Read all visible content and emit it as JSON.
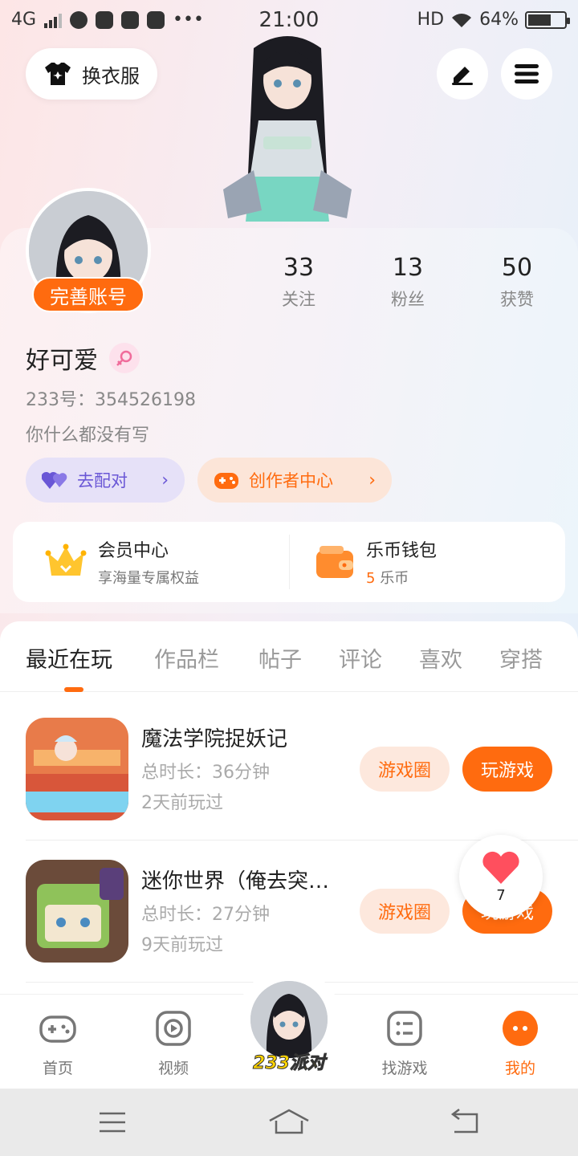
{
  "status_bar": {
    "network": "4G",
    "time": "21:00",
    "hd": "HD",
    "battery": "64%",
    "battery_level": 0.64
  },
  "header": {
    "change_clothes_label": "换衣服"
  },
  "profile": {
    "complete_account_label": "完善账号",
    "nickname": "好可爱",
    "id_line": "233号：354526198",
    "bio": "你什么都没有写",
    "stats": [
      {
        "value": "33",
        "label": "关注"
      },
      {
        "value": "13",
        "label": "粉丝"
      },
      {
        "value": "50",
        "label": "获赞"
      }
    ],
    "match_label": "去配对",
    "creator_label": "创作者中心"
  },
  "member": {
    "title": "会员中心",
    "subtitle": "享海量专属权益"
  },
  "wallet": {
    "title": "乐币钱包",
    "amount": "5",
    "unit": "乐币"
  },
  "tabs": [
    "最近在玩",
    "作品栏",
    "帖子",
    "评论",
    "喜欢",
    "穿搭"
  ],
  "games": [
    {
      "name": "魔法学院捉妖记",
      "duration": "总时长：36分钟",
      "last_played": "2天前玩过",
      "circle_label": "游戏圈",
      "play_label": "玩游戏"
    },
    {
      "name": "迷你世界（俺去突…",
      "duration": "总时长：27分钟",
      "last_played": "9天前玩过",
      "circle_label": "游戏圈",
      "play_label": "玩游戏"
    }
  ],
  "like_float": {
    "count": "7"
  },
  "nav": {
    "items": [
      "首页",
      "视频",
      "找游戏",
      "我的"
    ],
    "center_label": "233派对"
  },
  "colors": {
    "accent": "#ff6b0f",
    "purple": "#6a57d6"
  }
}
